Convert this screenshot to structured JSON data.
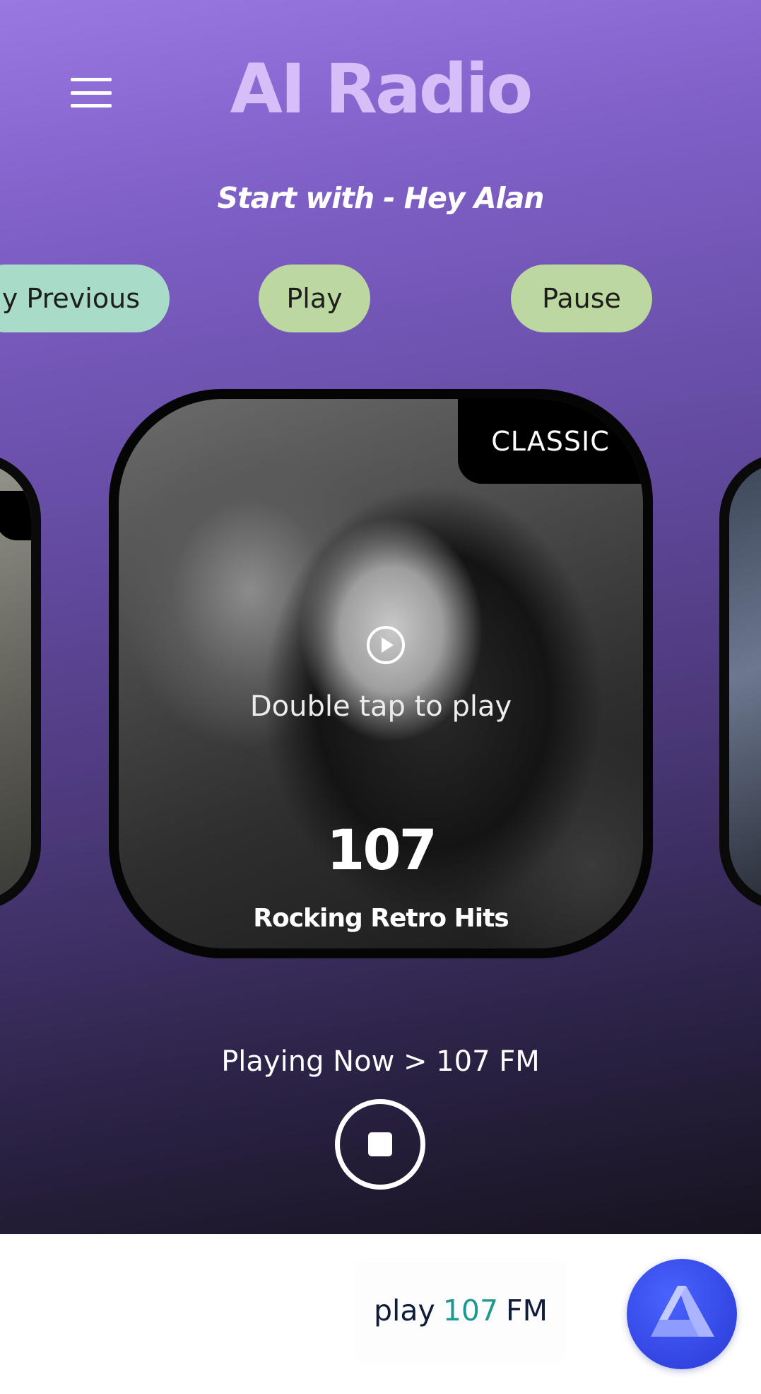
{
  "header": {
    "title": "AI Radio",
    "subtitle": "Start with - Hey Alan"
  },
  "commands": [
    {
      "label": "y Previous",
      "color": "#a8dcc8"
    },
    {
      "label": "Play",
      "color": "#bcd79f"
    },
    {
      "label": "Pause",
      "color": "#bcd79f"
    }
  ],
  "station_card": {
    "category": "CLASSIC",
    "hint": "Double tap to play",
    "frequency": "107",
    "name": "Rocking Retro Hits"
  },
  "player": {
    "now_playing": "Playing Now > 107 FM"
  },
  "voice_command": {
    "prefix": "play",
    "number": "107",
    "suffix": "FM",
    "accent_color": "#1e9a90"
  },
  "icons": {
    "menu": "hamburger-menu-icon",
    "play": "play-circle-icon",
    "stop": "stop-icon",
    "assistant": "alan-logo-icon"
  }
}
